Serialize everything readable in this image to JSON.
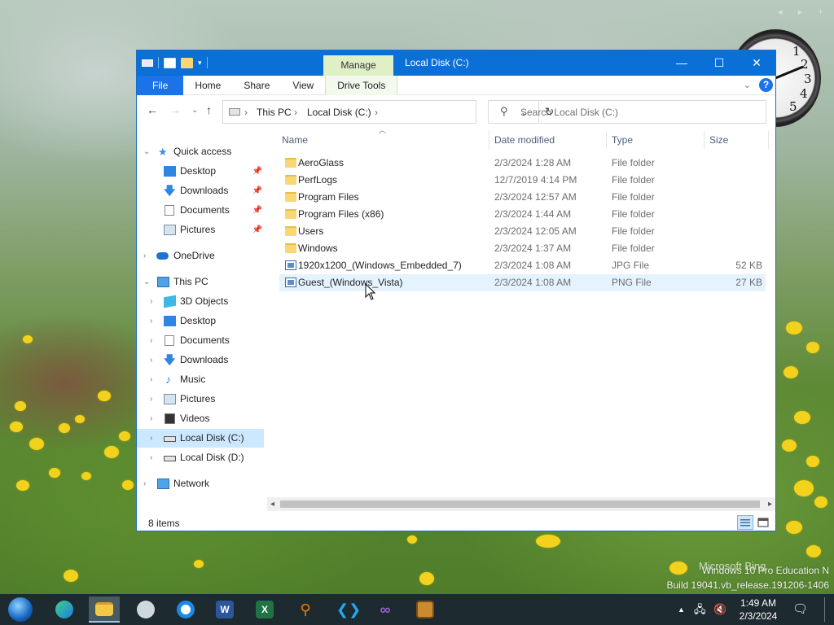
{
  "desktop": {
    "watermark_line1": "Windows 10 Pro Education N",
    "watermark_line2": "Build 19041.vb_release.191206-1406",
    "bing_text": "Microsoft Bing",
    "gadget_controls": "◂ ▸ +"
  },
  "clock_gadget": {
    "numerals": [
      "1",
      "2",
      "3",
      "4",
      "5"
    ]
  },
  "window": {
    "title": "Local Disk (C:)",
    "manage_tab": "Manage",
    "controls": {
      "minimize": "—",
      "maximize": "☐",
      "close": "✕"
    },
    "ribbon_tabs": [
      "File",
      "Home",
      "Share",
      "View",
      "Drive Tools"
    ],
    "address": {
      "root": "This PC",
      "drive": "Local Disk (C:)"
    },
    "search_placeholder": "Search Local Disk (C:)",
    "columns": [
      "Name",
      "Date modified",
      "Type",
      "Size"
    ],
    "files": [
      {
        "name": "AeroGlass",
        "date": "2/3/2024 1:28 AM",
        "type": "File folder",
        "size": "",
        "icon": "folder-icon"
      },
      {
        "name": "PerfLogs",
        "date": "12/7/2019 4:14 PM",
        "type": "File folder",
        "size": "",
        "icon": "folder-icon"
      },
      {
        "name": "Program Files",
        "date": "2/3/2024 12:57 AM",
        "type": "File folder",
        "size": "",
        "icon": "folder-icon"
      },
      {
        "name": "Program Files (x86)",
        "date": "2/3/2024 1:44 AM",
        "type": "File folder",
        "size": "",
        "icon": "folder-icon"
      },
      {
        "name": "Users",
        "date": "2/3/2024 12:05 AM",
        "type": "File folder",
        "size": "",
        "icon": "folder-icon"
      },
      {
        "name": "Windows",
        "date": "2/3/2024 1:37 AM",
        "type": "File folder",
        "size": "",
        "icon": "folder-icon"
      },
      {
        "name": "1920x1200_(Windows_Embedded_7)",
        "date": "2/3/2024 1:08 AM",
        "type": "JPG File",
        "size": "52 KB",
        "icon": "image-file-icon"
      },
      {
        "name": "Guest_(Windows_Vista)",
        "date": "2/3/2024 1:08 AM",
        "type": "PNG File",
        "size": "27 KB",
        "icon": "image-file-icon"
      }
    ],
    "status_count": "8 items"
  },
  "navpane": {
    "items": [
      {
        "label": "Quick access",
        "icon": "star-icon"
      },
      {
        "label": "Desktop",
        "icon": "desktop-icon"
      },
      {
        "label": "Downloads",
        "icon": "download-icon"
      },
      {
        "label": "Documents",
        "icon": "document-icon"
      },
      {
        "label": "Pictures",
        "icon": "picture-icon"
      },
      {
        "label": "OneDrive",
        "icon": "cloud-icon"
      },
      {
        "label": "This PC",
        "icon": "computer-icon"
      },
      {
        "label": "3D Objects",
        "icon": "cube-icon"
      },
      {
        "label": "Desktop",
        "icon": "desktop-icon"
      },
      {
        "label": "Documents",
        "icon": "document-icon"
      },
      {
        "label": "Downloads",
        "icon": "download-icon"
      },
      {
        "label": "Music",
        "icon": "music-icon"
      },
      {
        "label": "Pictures",
        "icon": "picture-icon"
      },
      {
        "label": "Videos",
        "icon": "video-icon"
      },
      {
        "label": "Local Disk (C:)",
        "icon": "drive-icon"
      },
      {
        "label": "Local Disk (D:)",
        "icon": "drive-icon"
      },
      {
        "label": "Network",
        "icon": "network-icon"
      }
    ]
  },
  "taskbar": {
    "time": "1:49 AM",
    "date": "2/3/2024",
    "apps": [
      "start-orb",
      "edge",
      "file-explorer",
      "steam",
      "chrome",
      "word",
      "excel",
      "search-tool",
      "vscode",
      "visual-studio",
      "codeblocks"
    ]
  },
  "colors": {
    "accent": "#0a6fd6",
    "selection": "#cce8ff",
    "hover": "#e5f3ff"
  }
}
